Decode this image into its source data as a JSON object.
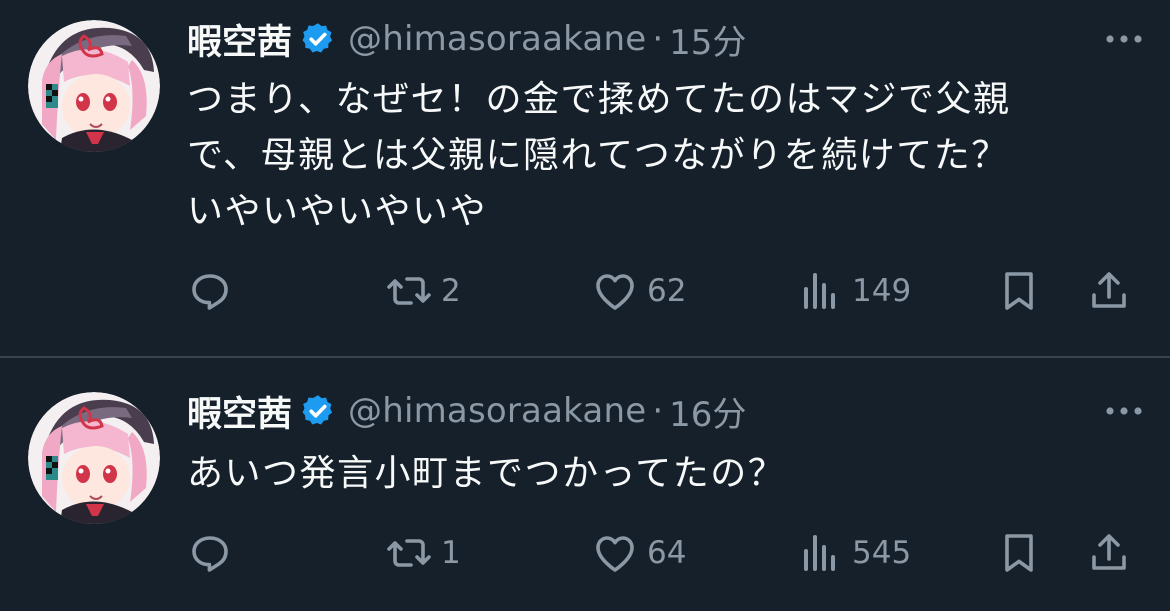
{
  "tweets": [
    {
      "display_name": "暇空茜",
      "handle": "@himasoraakane",
      "separator": "·",
      "time": "15分",
      "text_lines": [
        "つまり、なぜセ！の金で揉めてたのはマジで父親",
        "で、母親とは父親に隠れてつながりを続けてた？",
        "いやいやいやいや"
      ],
      "retweets": "2",
      "likes": "62",
      "views": "149"
    },
    {
      "display_name": "暇空茜",
      "handle": "@himasoraakane",
      "separator": "·",
      "time": "16分",
      "text_lines": [
        "あいつ発言小町までつかってたの？"
      ],
      "retweets": "1",
      "likes": "64",
      "views": "545"
    }
  ],
  "colors": {
    "background": "#15202b",
    "text": "#f7f9f9",
    "secondary": "#8b98a5",
    "verified": "#1d9bf0",
    "divider": "#38444d"
  },
  "icons": [
    "verified-badge-icon",
    "more-icon",
    "reply-icon",
    "retweet-icon",
    "like-icon",
    "views-icon",
    "bookmark-icon",
    "share-icon"
  ]
}
